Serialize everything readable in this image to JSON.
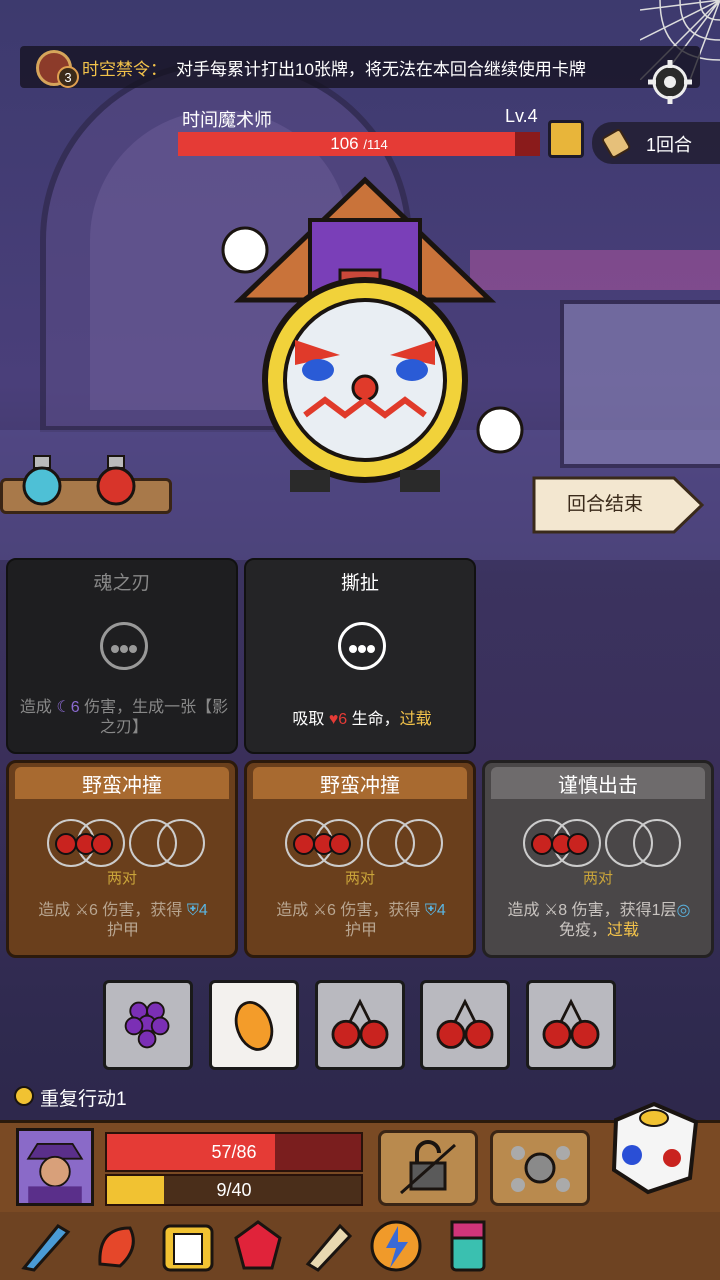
{
  "banner": {
    "count": "3",
    "title": "时空禁令：",
    "text": "对手每累计打出10张牌，将无法在本回合继续使用卡牌"
  },
  "enemy": {
    "name": "时间魔术师",
    "level": "Lv.4",
    "hp": "106",
    "hp_max": "/114",
    "hp_fraction": 0.93
  },
  "turn": {
    "label": "1回合"
  },
  "end_turn": {
    "label": "回合结束"
  },
  "skill_cards": [
    {
      "title": "魂之刃",
      "desc_pre": "造成 ",
      "value": "6",
      "desc_post": " 伤害，生成一张【影之刃】"
    },
    {
      "title": "撕扯",
      "desc_pre": "吸取 ",
      "value": "6",
      "desc_post": " 生命，",
      "keyword": "过载"
    }
  ],
  "dice_cards": [
    {
      "title": "野蛮冲撞",
      "requirement": "两对",
      "desc_pre": "造成 ",
      "dmg": "6",
      "desc_mid": " 伤害，获得 ",
      "armor": "4",
      "desc_post": "护甲"
    },
    {
      "title": "野蛮冲撞",
      "requirement": "两对",
      "desc_pre": "造成 ",
      "dmg": "6",
      "desc_mid": " 伤害，获得 ",
      "armor": "4",
      "desc_post": "护甲"
    },
    {
      "title": "谨慎出击",
      "requirement": "两对",
      "desc_pre": "造成 ",
      "dmg": "8",
      "desc_mid": " 伤害，获得1层",
      "desc_post": "免疫，",
      "keyword": "过载"
    }
  ],
  "dice": [
    "grape-icon",
    "mango-icon",
    "cherry-icon",
    "cherry-icon",
    "cherry-icon"
  ],
  "repeat": {
    "label": "重复行动1"
  },
  "player": {
    "hp": "57/86",
    "hp_fraction": 0.66,
    "energy": "9/40",
    "energy_fraction": 0.225
  },
  "colors": {
    "hp_red": "#e53b36",
    "energy_yellow": "#f1c232",
    "keyword_yellow": "#f3c34a",
    "purple_dmg": "#8b6ad1"
  },
  "relics": [
    "fish-relic-icon",
    "fire-spirit-relic-icon",
    "card-box-relic-icon",
    "ruby-relic-icon",
    "horn-relic-icon",
    "lightning-orb-relic-icon",
    "totem-relic-icon"
  ]
}
